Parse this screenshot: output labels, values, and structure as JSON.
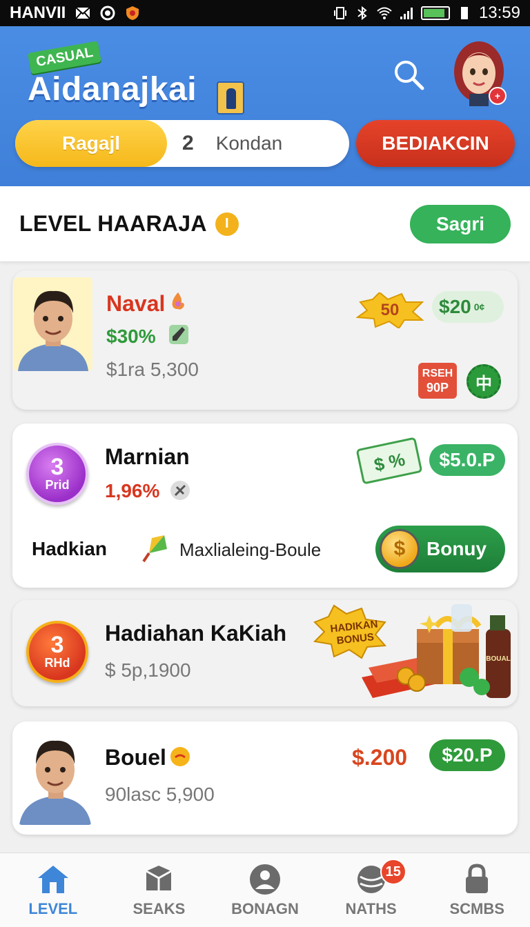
{
  "status_bar": {
    "carrier": "HANVII",
    "time": "13:59"
  },
  "header": {
    "logo_tag": "CASUAL",
    "logo_text": "Aidanajkai",
    "tabs": {
      "active_label": "Ragajl",
      "count": "2",
      "other_label": "Kondan"
    },
    "action_button": "BEDIAKCIN"
  },
  "section": {
    "title": "LEVEL HAARAJA",
    "info_badge": "I",
    "button_label": "Sagri"
  },
  "cards": [
    {
      "name": "Naval",
      "sub": "$30%",
      "meta": "$1ra 5,300",
      "burst_label": "50",
      "amount": "$20",
      "amount_suffix": "0¢",
      "tag_line1": "RSEH",
      "tag_line2": "90P",
      "seal_label": "中"
    },
    {
      "rank_num": "3",
      "rank_label": "Prid",
      "name": "Marnian",
      "sub": "1,96%",
      "ticket_label": "$ %",
      "amount": "$5.0.P",
      "left_label": "Hadkian",
      "middle_label": "Maxlialeing-Boule",
      "bonus_button": "Bonuy",
      "coin_symbol": "$"
    },
    {
      "rank_num": "3",
      "rank_label": "RHd",
      "name": "Hadiahan KaKiah",
      "meta": "$ 5p,1900",
      "burst_line1": "HADIKAN",
      "burst_line2": "BONUS",
      "bottle_label": "BOUAL"
    },
    {
      "name": "Bouel",
      "meta": "90lasc 5,900",
      "price": "$.200",
      "amount": "$20.P"
    }
  ],
  "bottom_nav": [
    {
      "label": "LEVEL",
      "icon": "home-icon",
      "active": true
    },
    {
      "label": "SEAKS",
      "icon": "box-icon",
      "active": false
    },
    {
      "label": "BONAGN",
      "icon": "user-icon",
      "active": false
    },
    {
      "label": "NATHS",
      "icon": "globe-icon",
      "active": false,
      "badge": "15"
    },
    {
      "label": "SCMBS",
      "icon": "lock-icon",
      "active": false
    }
  ],
  "colors": {
    "header_blue": "#4a8de4",
    "accent_yellow": "#f5b81a",
    "accent_red": "#d8361f",
    "accent_green": "#35b25a",
    "nav_active": "#3e86d8"
  }
}
